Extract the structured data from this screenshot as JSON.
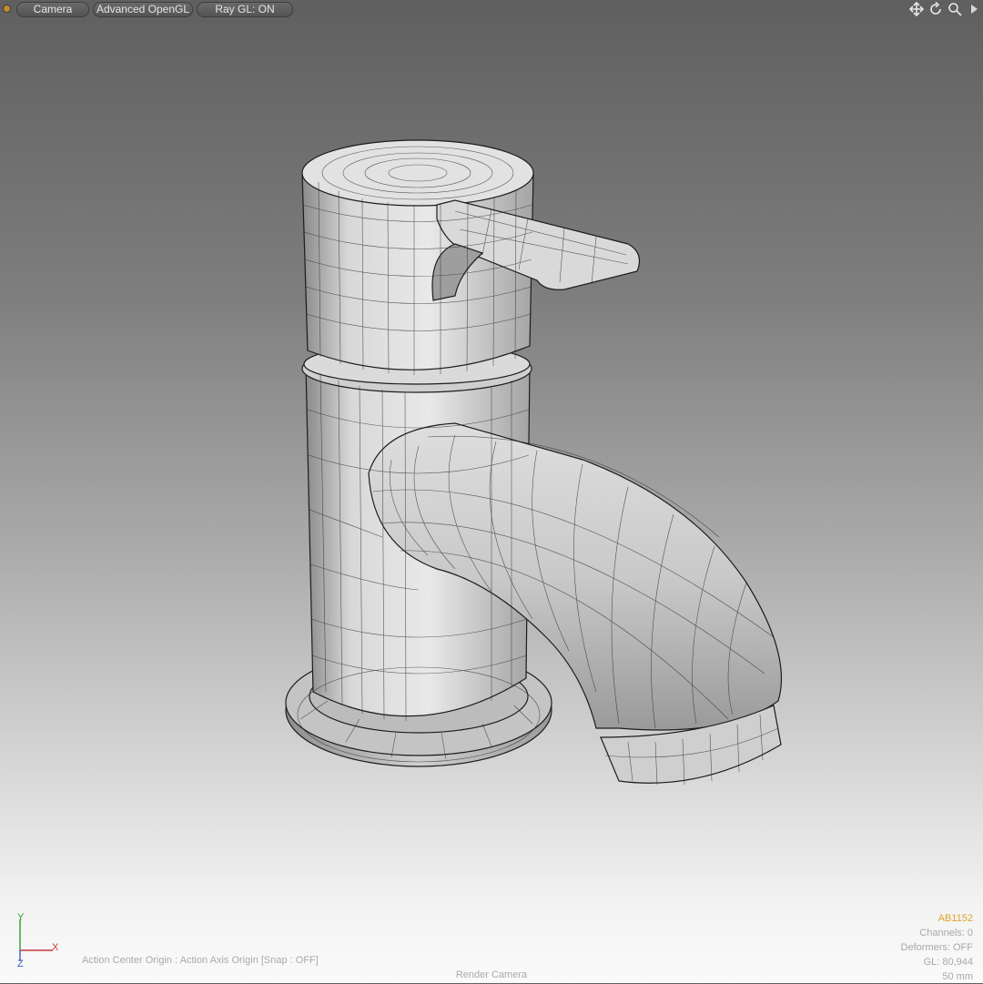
{
  "toolbar": {
    "camera_label": "Camera",
    "opengl_label": "Advanced OpenGL",
    "raygl_label": "Ray GL: ON"
  },
  "nav_icons": [
    "move-icon",
    "rotate-icon",
    "zoom-icon",
    "menu-arrow-icon"
  ],
  "axes": {
    "y": "Y",
    "x": "X",
    "z": "Z"
  },
  "status": {
    "action_center": "Action Center Origin : Action Axis Origin  [Snap : OFF]",
    "render_camera": "Render Camera"
  },
  "info": {
    "item_name": "AB1152",
    "channels": "Channels: 0",
    "deformers": "Deformers: OFF",
    "gl": "GL: 80,944",
    "focal": "50 mm"
  },
  "colors": {
    "accent": "#e0a22a",
    "axis_x": "#c23a3a",
    "axis_y": "#2e9b2e",
    "axis_z": "#3a5fc2"
  }
}
